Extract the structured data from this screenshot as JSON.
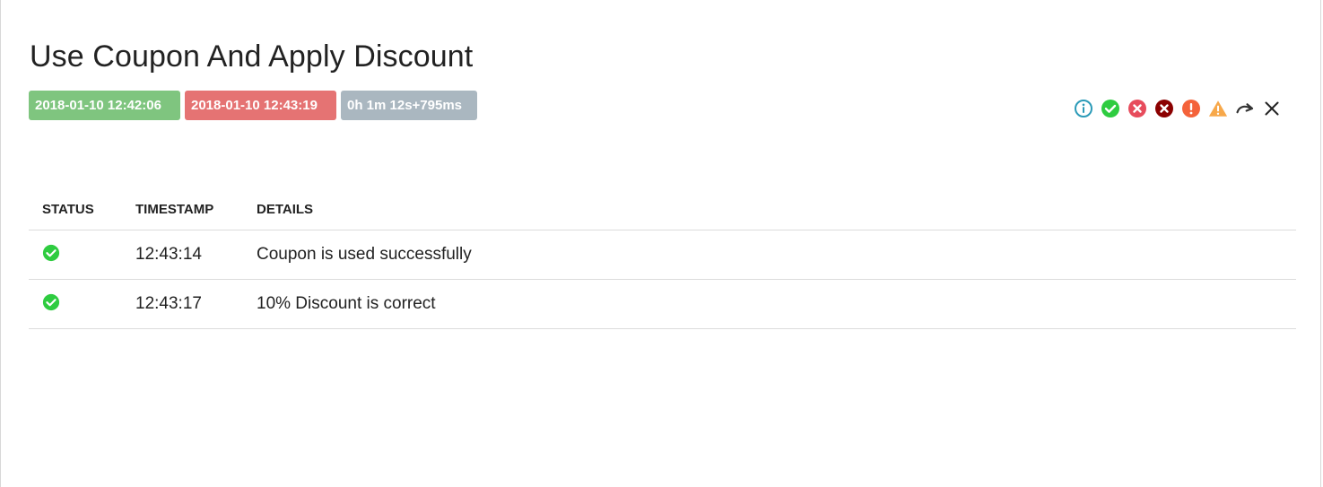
{
  "test": {
    "title": "Use Coupon And Apply Discount",
    "start_time": "2018-01-10 12:42:06",
    "end_time": "2018-01-10 12:43:19",
    "duration": "0h 1m 12s+795ms"
  },
  "filters": [
    {
      "name": "info",
      "icon": "info-icon",
      "color": "#2c9bb8"
    },
    {
      "name": "pass",
      "icon": "check-circle-icon",
      "color": "#2ecc40"
    },
    {
      "name": "fail",
      "icon": "x-circle-icon",
      "color": "#e74c5c"
    },
    {
      "name": "fatal",
      "icon": "x-circle-dark-icon",
      "color": "#8b0000"
    },
    {
      "name": "error",
      "icon": "exclamation-circle-icon",
      "color": "#f4623a"
    },
    {
      "name": "warning",
      "icon": "warning-triangle-icon",
      "color": "#f7a84a"
    },
    {
      "name": "skip",
      "icon": "redo-arrow-icon",
      "color": "#333333"
    },
    {
      "name": "clear",
      "icon": "close-icon",
      "color": "#222222"
    }
  ],
  "table": {
    "headers": {
      "status": "STATUS",
      "timestamp": "TIMESTAMP",
      "details": "DETAILS"
    },
    "rows": [
      {
        "status": "pass",
        "status_icon": "check-circle-icon",
        "timestamp": "12:43:14",
        "details": "Coupon is used successfully"
      },
      {
        "status": "pass",
        "status_icon": "check-circle-icon",
        "timestamp": "12:43:17",
        "details": "10% Discount is correct"
      }
    ]
  },
  "colors": {
    "start_badge": "#7fc57f",
    "end_badge": "#e57373",
    "duration_badge": "#aab7c0",
    "pass": "#2ecc40"
  }
}
